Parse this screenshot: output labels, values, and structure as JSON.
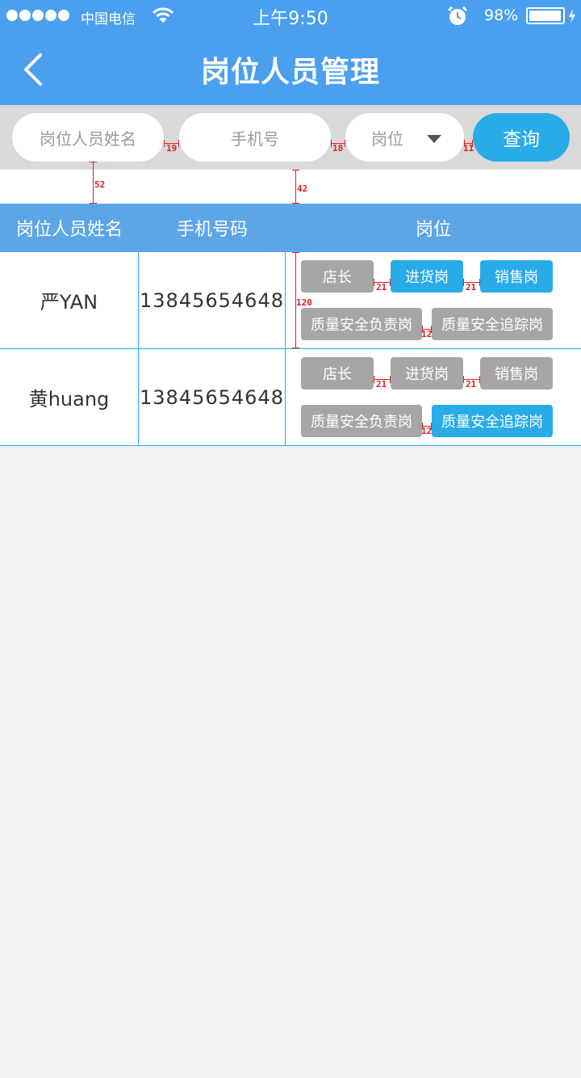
{
  "status_bar": {
    "carrier": "中国电信",
    "time": "上午9:50",
    "battery_percent": "98%",
    "battery_level": 0.98
  },
  "header": {
    "title": "岗位人员管理"
  },
  "search": {
    "name_placeholder": "岗位人员姓名",
    "phone_placeholder": "手机号",
    "post_placeholder": "岗位",
    "query_label": "查询"
  },
  "table": {
    "headers": [
      "岗位人员姓名",
      "手机号码",
      "岗位"
    ],
    "rows": [
      {
        "name": "严YAN",
        "phone": "13845654648",
        "tags": [
          {
            "label": "店长",
            "selected": false
          },
          {
            "label": "进货岗",
            "selected": true
          },
          {
            "label": "销售岗",
            "selected": true
          },
          {
            "label": "质量安全负责岗",
            "selected": false
          },
          {
            "label": "质量安全追踪岗",
            "selected": false
          }
        ]
      },
      {
        "name": "黄huang",
        "phone": "13845654648",
        "tags": [
          {
            "label": "店长",
            "selected": false
          },
          {
            "label": "进货岗",
            "selected": false
          },
          {
            "label": "销售岗",
            "selected": false
          },
          {
            "label": "质量安全负责岗",
            "selected": false
          },
          {
            "label": "质量安全追踪岗",
            "selected": true
          }
        ]
      }
    ]
  },
  "annotations": [
    "19",
    "18",
    "11",
    "52",
    "42",
    "120",
    "21",
    "21",
    "12",
    "21",
    "21",
    "12"
  ],
  "colors": {
    "primary": "#4aa0ee",
    "accent": "#29abe8",
    "tag_off": "#a6a6a6",
    "annotation": "#e02020"
  }
}
